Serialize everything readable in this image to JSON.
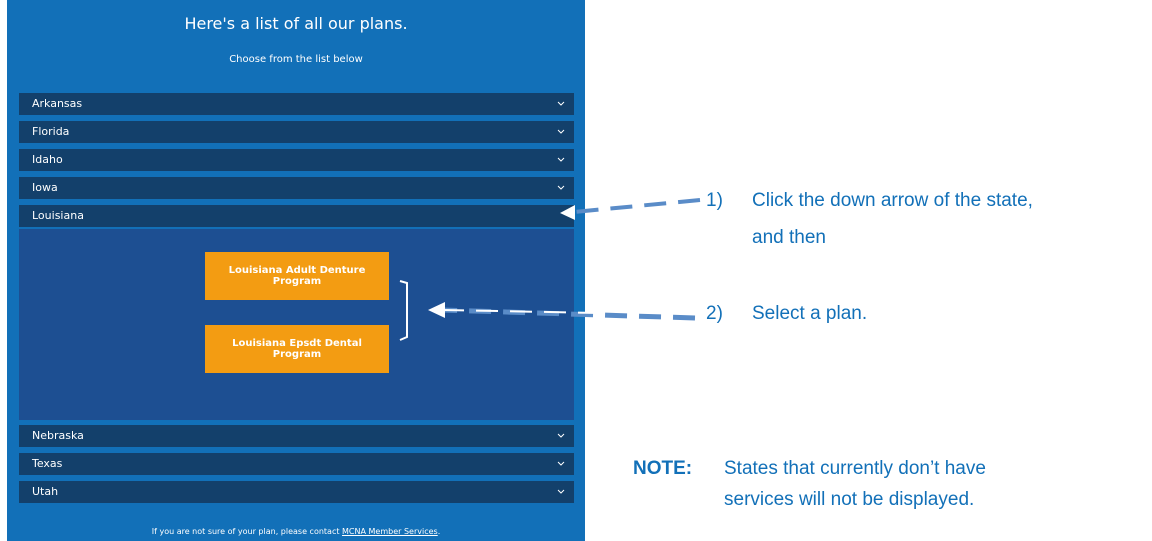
{
  "panel": {
    "title": "Here's a list of all our plans.",
    "subtitle": "Choose from the list below",
    "states_top": [
      "Arkansas",
      "Florida",
      "Idaho",
      "Iowa"
    ],
    "expanded_state": "Louisiana",
    "plans": [
      "Louisiana Adult Denture Program",
      "Louisiana Epsdt Dental Program"
    ],
    "states_bottom": [
      "Nebraska",
      "Texas",
      "Utah"
    ],
    "footer_text": "If you are not sure of your plan, please contact ",
    "footer_link": "MCNA Member Services",
    "footer_end": "."
  },
  "instructions": {
    "step1_num": "1)",
    "step1_line1": "Click the down arrow of the state,",
    "step1_line2": "and then",
    "step2_num": "2)",
    "step2_text": "Select a plan.",
    "note_label": "NOTE:",
    "note_line1": "States that currently don’t have",
    "note_line2": "services will not be displayed."
  },
  "colors": {
    "panel_bg": "#1270b8",
    "row_bg": "#13406b",
    "expanded_bg": "#1d4f92",
    "button_bg": "#f39c12",
    "annotation": "#1270b8"
  }
}
